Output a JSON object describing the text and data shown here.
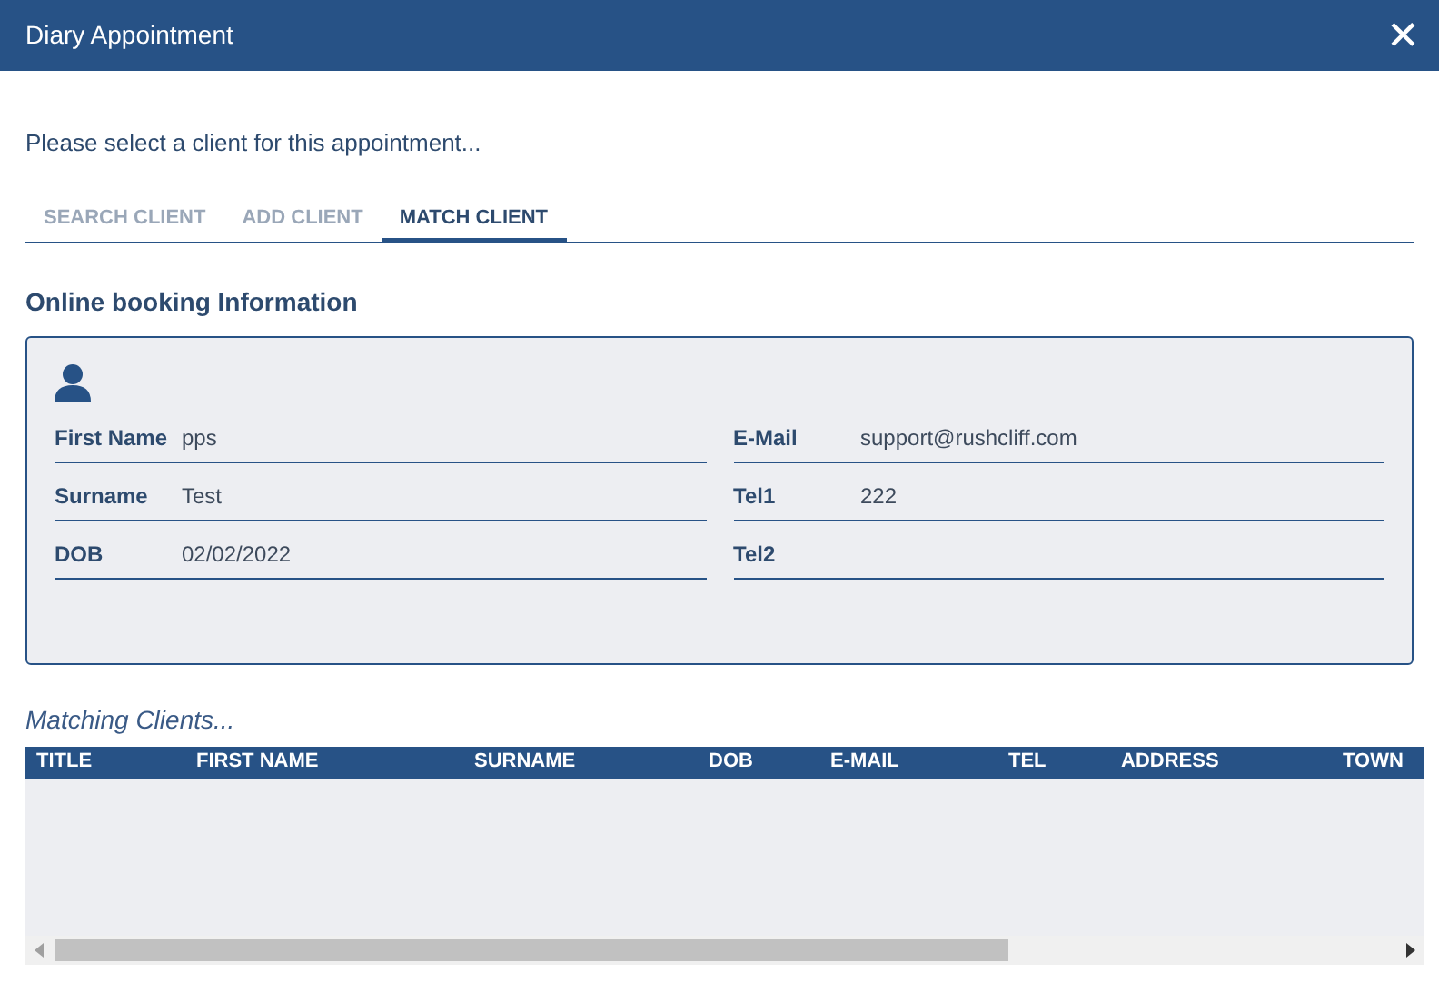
{
  "window": {
    "title": "Diary Appointment",
    "close": "✕"
  },
  "prompt": "Please select a client for this appointment...",
  "tabs": [
    {
      "label": "SEARCH CLIENT",
      "selected": false
    },
    {
      "label": "ADD CLIENT",
      "selected": false
    },
    {
      "label": "MATCH CLIENT",
      "selected": true
    }
  ],
  "section_title": "Online booking Information",
  "fields_left": [
    {
      "label": "First Name",
      "value": "pps"
    },
    {
      "label": "Surname",
      "value": "Test"
    },
    {
      "label": "DOB",
      "value": "02/02/2022"
    }
  ],
  "fields_right": [
    {
      "label": "E-Mail",
      "value": "support@rushcliff.com"
    },
    {
      "label": "Tel1",
      "value": "222"
    },
    {
      "label": "Tel2"
    }
  ],
  "matching_title": "Matching Clients...",
  "table": {
    "columns": [
      "TITLE",
      "FIRST NAME",
      "SURNAME",
      "DOB",
      "E-MAIL",
      "TEL",
      "ADDRESS",
      "TOWN"
    ]
  }
}
